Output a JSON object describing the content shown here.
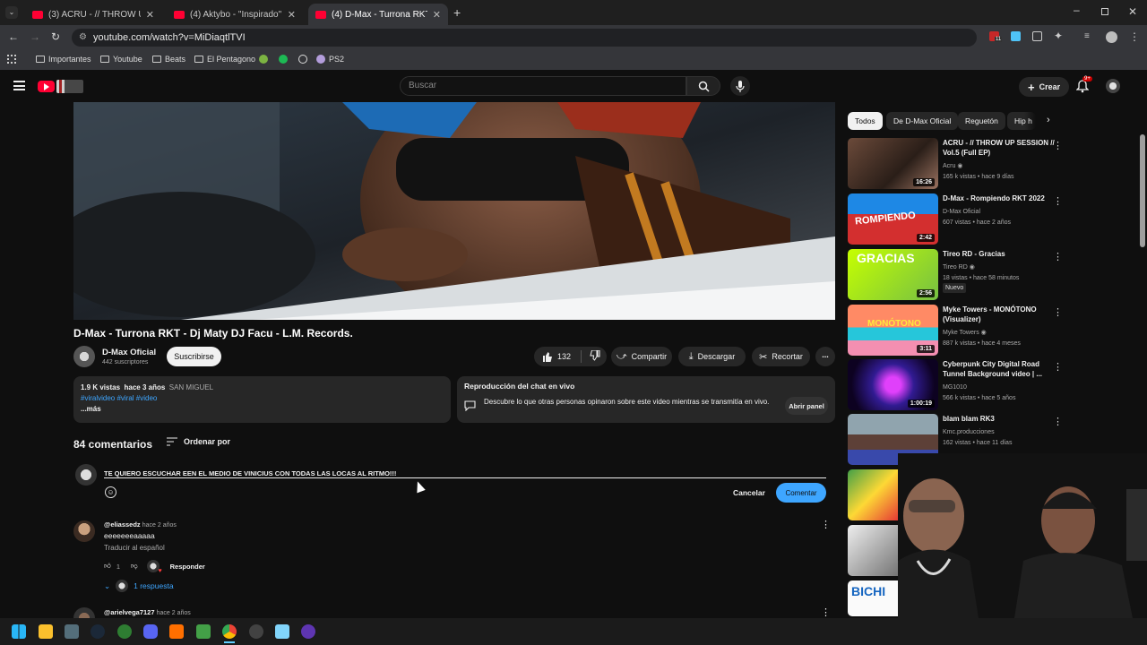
{
  "browser": {
    "tabs": [
      {
        "title": "(3) ACRU - // THROW UP SESSI",
        "active": false
      },
      {
        "title": "(4) Aktybo - \"Inspirado\" (video",
        "active": false
      },
      {
        "title": "(4) D-Max - Turrona RKT - Dj M",
        "active": true
      }
    ],
    "url": "youtube.com/watch?v=MiDiaqtlTVI",
    "bookmarks": [
      "Importantes",
      "Youtube",
      "Beats",
      "El Pentagono",
      "PS2"
    ],
    "extension_badge": "11"
  },
  "header": {
    "search_placeholder": "Buscar",
    "create_label": "Crear",
    "notifications_badge": "9+"
  },
  "video": {
    "title": "D-Max - Turrona RKT - Dj Maty DJ Facu - L.M. Records.",
    "channel": "D-Max Oficial",
    "subscribers": "442 suscriptores",
    "subscribe_label": "Suscribirse",
    "likes": "132",
    "share_label": "Compartir",
    "download_label": "Descargar",
    "clip_label": "Recortar",
    "more_label": "...",
    "views": "1.9 K vistas",
    "age": "hace 3 años",
    "location": "SAN MIGUEL",
    "hashtags": "#viralvideo  #viral #video",
    "more_desc": "...más"
  },
  "chat_replay": {
    "title": "Reproducción del chat en vivo",
    "text": "Descubre lo que otras personas opinaron sobre este video mientras se transmitía en vivo.",
    "button": "Abrir panel"
  },
  "comments": {
    "count_label": "84 comentarios",
    "sort_label": "Ordenar por",
    "draft": "TE QUIERO ESCUCHAR EEN EL MEDIO DE VINICIUS CON TODAS LAS LOCAS AL RITMO!!!",
    "cancel_label": "Cancelar",
    "submit_label": "Comentar",
    "list": [
      {
        "author": "@eliassedz",
        "age": "hace 2 años",
        "text": "eeeeeeeaaaaa",
        "translate": "Traducir al español",
        "likes": "1",
        "reply_label": "Responder",
        "replies": "1 respuesta"
      },
      {
        "author": "@arielvega7127",
        "age": "hace 2 años"
      }
    ]
  },
  "sidebar": {
    "chips": [
      "Todos",
      "De D-Max Oficial",
      "Reguetón",
      "Hip h"
    ],
    "recommendations": [
      {
        "title": "ACRU - // THROW UP SESSION // Vol.5 (Full EP)",
        "channel": "Acru",
        "verified": true,
        "views": "165 k vistas",
        "age": "hace 9 días",
        "duration": "16:26",
        "badge": ""
      },
      {
        "title": "D-Max - Rompiendo RKT 2022",
        "channel": "D-Max Oficial",
        "verified": false,
        "views": "607 vistas",
        "age": "hace 2 años",
        "duration": "2:42",
        "badge": ""
      },
      {
        "title": "Tireo RD - Gracias",
        "channel": "Tireo RD",
        "verified": true,
        "views": "18 vistas",
        "age": "hace 58 minutos",
        "duration": "2:56",
        "badge": "Nuevo"
      },
      {
        "title": "Myke Towers - MONÓTONO (Visualizer)",
        "channel": "Myke Towers",
        "verified": true,
        "views": "887 k vistas",
        "age": "hace 4 meses",
        "duration": "3:11",
        "badge": ""
      },
      {
        "title": "Cyberpunk City Digital Road Tunnel Background video | ...",
        "channel": "MG1010",
        "verified": false,
        "views": "566 k vistas",
        "age": "hace 5 años",
        "duration": "1:00:19",
        "badge": ""
      },
      {
        "title": "blam blam RK3",
        "channel": "Kmc.producciones",
        "verified": false,
        "views": "162 vistas",
        "age": "hace 11 días",
        "duration": "",
        "badge": ""
      }
    ],
    "thumb_texts": [
      "ROMPIENDO",
      "GRACIAS",
      "MONÓTONO",
      "BICHI"
    ]
  }
}
